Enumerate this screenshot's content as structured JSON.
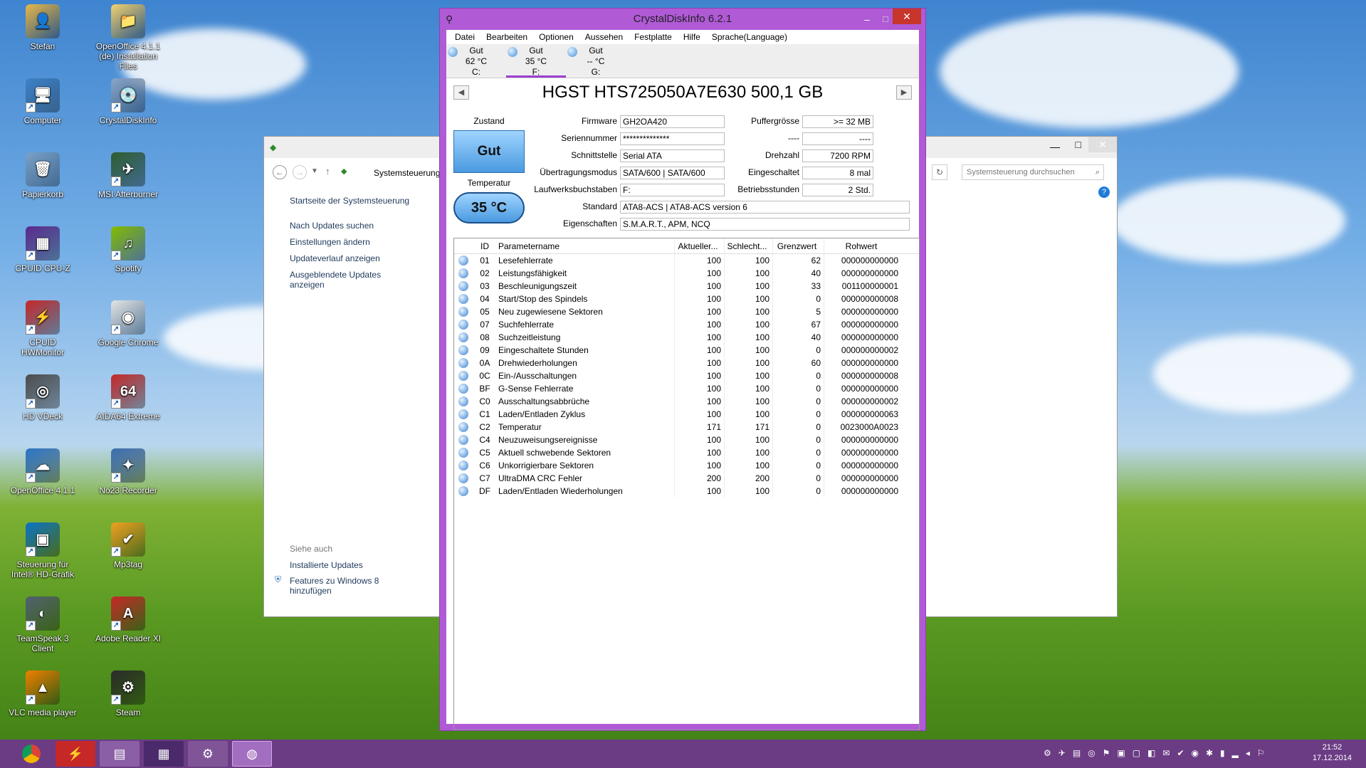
{
  "desktop": {
    "icons": [
      {
        "label": "Stefan",
        "color": "#e8b847",
        "sym": "👤"
      },
      {
        "label": "OpenOffice 4.1.1 (de) Installation Files",
        "color": "#f3d26c",
        "sym": "📁"
      },
      {
        "label": "Computer",
        "color": "#3c82c8",
        "sym": "🖥"
      },
      {
        "label": "CrystalDiskInfo",
        "color": "#8aa6c8",
        "sym": "💿"
      },
      {
        "label": "Papierkorb",
        "color": "#7aa2c9",
        "sym": "🗑"
      },
      {
        "label": "MSI Afterburner",
        "color": "#2f5e2f",
        "sym": "✈"
      },
      {
        "label": "CPUID CPU-Z",
        "color": "#5b2a8f",
        "sym": "▦"
      },
      {
        "label": "Spotify",
        "color": "#84bd00",
        "sym": "♫"
      },
      {
        "label": "CPUID HWMonitor",
        "color": "#c62828",
        "sym": "⚡"
      },
      {
        "label": "Google Chrome",
        "color": "#e5e5e5",
        "sym": "◉"
      },
      {
        "label": "HD VDeck",
        "color": "#4d4d4d",
        "sym": "◎"
      },
      {
        "label": "AIDA64 Extreme",
        "color": "#c62828",
        "sym": "64"
      },
      {
        "label": "OpenOffice 4.1.1",
        "color": "#2a75c5",
        "sym": "☁"
      },
      {
        "label": "No23 Recorder",
        "color": "#3a6fb0",
        "sym": "✦"
      },
      {
        "label": "Steuerung für Intel® HD-Grafik",
        "color": "#0a73c4",
        "sym": "▣"
      },
      {
        "label": "Mp3tag",
        "color": "#f0a020",
        "sym": "✔"
      },
      {
        "label": "TeamSpeak 3 Client",
        "color": "#506070",
        "sym": "◐"
      },
      {
        "label": "Adobe Reader XI",
        "color": "#c62828",
        "sym": "A"
      },
      {
        "label": "VLC media player",
        "color": "#f08000",
        "sym": "▲"
      },
      {
        "label": "Steam",
        "color": "#2a2a2a",
        "sym": "⚙"
      }
    ]
  },
  "control_panel": {
    "breadcrumb": "Systemsteuerung",
    "search_placeholder": "Systemsteuerung durchsuchen",
    "home_link": "Startseite der Systemsteuerung",
    "links": [
      "Nach Updates suchen",
      "Einstellungen ändern",
      "Updateverlauf anzeigen",
      "Ausgeblendete Updates anzeigen"
    ],
    "see_also": "Siehe auch",
    "see_also_links": [
      "Installierte Updates",
      "Features zu Windows 8 hinzufügen"
    ]
  },
  "crystal": {
    "title": "CrystalDiskInfo 6.2.1",
    "menu": [
      "Datei",
      "Bearbeiten",
      "Optionen",
      "Aussehen",
      "Festplatte",
      "Hilfe",
      "Sprache(Language)"
    ],
    "drives": [
      {
        "status": "Gut",
        "temp": "62 °C",
        "letter": "C:"
      },
      {
        "status": "Gut",
        "temp": "35 °C",
        "letter": "F:"
      },
      {
        "status": "Gut",
        "temp": "-- °C",
        "letter": "G:"
      }
    ],
    "model": "HGST HTS725050A7E630 500,1 GB",
    "zustand_label": "Zustand",
    "health": "Gut",
    "temperatur_label": "Temperatur",
    "temperature": "35 °C",
    "fields": {
      "firmware_label": "Firmware",
      "firmware": "GH2OA420",
      "serial_label": "Seriennummer",
      "serial": "**************",
      "interface_label": "Schnittstelle",
      "interface": "Serial ATA",
      "transfer_label": "Übertragungsmodus",
      "transfer": "SATA/600 | SATA/600",
      "letters_label": "Laufwerksbuchstaben",
      "letters": "F:",
      "standard_label": "Standard",
      "standard": "ATA8-ACS | ATA8-ACS version 6",
      "features_label": "Eigenschaften",
      "features": "S.M.A.R.T., APM, NCQ",
      "buffer_label": "Puffergrösse",
      "buffer": ">= 32 MB",
      "blank_label": "----",
      "blank": "----",
      "rpm_label": "Drehzahl",
      "rpm": "7200 RPM",
      "poweron_count_label": "Eingeschaltet",
      "poweron_count": "8 mal",
      "hours_label": "Betriebsstunden",
      "hours": "2 Std."
    },
    "table": {
      "headers": [
        "ID",
        "Parametername",
        "Aktueller...",
        "Schlecht...",
        "Grenzwert",
        "Rohwert"
      ],
      "rows": [
        [
          "01",
          "Lesefehlerrate",
          "100",
          "100",
          "62",
          "000000000000"
        ],
        [
          "02",
          "Leistungsfähigkeit",
          "100",
          "100",
          "40",
          "000000000000"
        ],
        [
          "03",
          "Beschleunigungszeit",
          "100",
          "100",
          "33",
          "001100000001"
        ],
        [
          "04",
          "Start/Stop des Spindels",
          "100",
          "100",
          "0",
          "000000000008"
        ],
        [
          "05",
          "Neu zugewiesene Sektoren",
          "100",
          "100",
          "5",
          "000000000000"
        ],
        [
          "07",
          "Suchfehlerrate",
          "100",
          "100",
          "67",
          "000000000000"
        ],
        [
          "08",
          "Suchzeitleistung",
          "100",
          "100",
          "40",
          "000000000000"
        ],
        [
          "09",
          "Eingeschaltete Stunden",
          "100",
          "100",
          "0",
          "000000000002"
        ],
        [
          "0A",
          "Drehwiederholungen",
          "100",
          "100",
          "60",
          "000000000000"
        ],
        [
          "0C",
          "Ein-/Ausschaltungen",
          "100",
          "100",
          "0",
          "000000000008"
        ],
        [
          "BF",
          "G-Sense Fehlerrate",
          "100",
          "100",
          "0",
          "000000000000"
        ],
        [
          "C0",
          "Ausschaltungsabbrüche",
          "100",
          "100",
          "0",
          "000000000002"
        ],
        [
          "C1",
          "Laden/Entladen Zyklus",
          "100",
          "100",
          "0",
          "000000000063"
        ],
        [
          "C2",
          "Temperatur",
          "171",
          "171",
          "0",
          "0023000A0023"
        ],
        [
          "C4",
          "Neuzuweisungsereignisse",
          "100",
          "100",
          "0",
          "000000000000"
        ],
        [
          "C5",
          "Aktuell schwebende Sektoren",
          "100",
          "100",
          "0",
          "000000000000"
        ],
        [
          "C6",
          "Unkorrigierbare Sektoren",
          "100",
          "100",
          "0",
          "000000000000"
        ],
        [
          "C7",
          "UltraDMA CRC Fehler",
          "200",
          "200",
          "0",
          "000000000000"
        ],
        [
          "DF",
          "Laden/Entladen Wiederholungen",
          "100",
          "100",
          "0",
          "000000000000"
        ]
      ]
    }
  },
  "taskbar": {
    "time": "21:52",
    "date": "17.12.2014"
  }
}
